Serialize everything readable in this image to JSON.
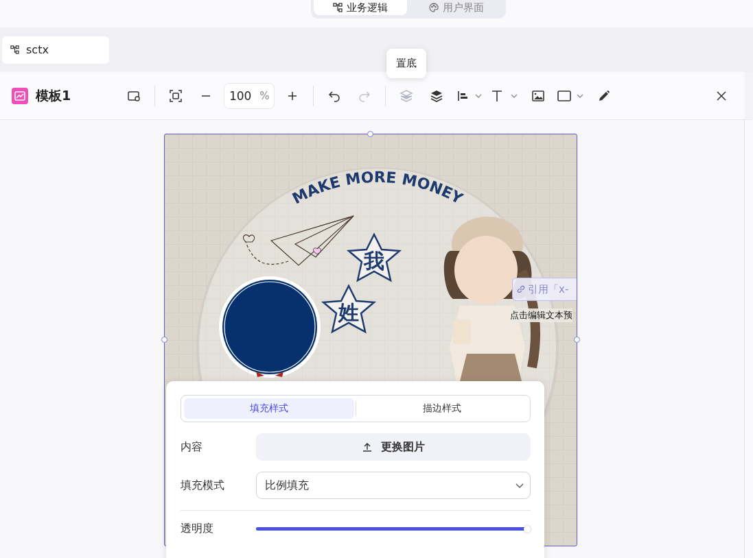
{
  "top_tabs": [
    {
      "label": "业务逻辑",
      "selected": true
    },
    {
      "label": "用户界面",
      "selected": false
    }
  ],
  "file_tab": {
    "label": "sctx"
  },
  "toolbar": {
    "title": "模板1",
    "zoom": "100",
    "zoom_unit": "%",
    "tooltip": "置底",
    "redo_disabled": true
  },
  "canvas": {
    "artwork": {
      "heading": "MAKE MORE MONEY",
      "stars": [
        "我",
        "姓"
      ]
    },
    "reference_chip": "引用「x-",
    "text_preview": "点击编辑文本预"
  },
  "panel": {
    "tabs": [
      {
        "label": "填充样式",
        "selected": true
      },
      {
        "label": "描边样式",
        "selected": false
      }
    ],
    "content_label": "内容",
    "replace_button": "更换图片",
    "fill_mode_label": "填充模式",
    "fill_mode": "比例填充",
    "opacity_label": "透明度",
    "opacity": {
      "level": 1
    }
  }
}
